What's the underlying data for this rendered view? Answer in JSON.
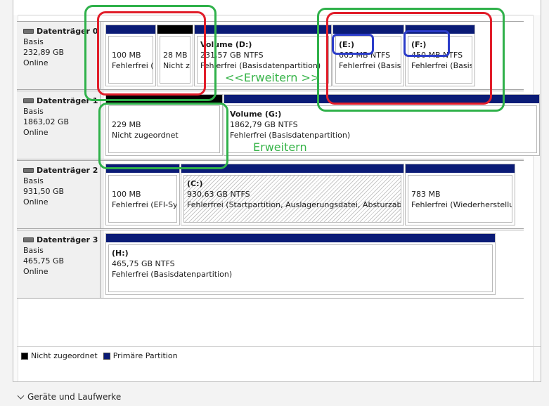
{
  "disks": [
    {
      "title": "Datenträger 0",
      "type": "Basis",
      "size": "232,89 GB",
      "status": "Online",
      "partitions": [
        {
          "l1": "100 MB",
          "l2": "Fehlerfrei ("
        },
        {
          "l1": "28 MB",
          "l2": "Nicht z"
        },
        {
          "l1": "Volume  (D:)",
          "l2": "231,57 GB NTFS",
          "l3": "Fehlerfrei (Basisdatenpartition)"
        },
        {
          "l1": "(E:)",
          "l2": "665 MB NTFS",
          "l3": "Fehlerfrei (Basisd"
        },
        {
          "l1": "(F:)",
          "l2": "450 MB NTFS",
          "l3": "Fehlerfrei (Basis"
        }
      ]
    },
    {
      "title": "Datenträger 1",
      "type": "Basis",
      "size": "1863,02 GB",
      "status": "Online",
      "partitions": [
        {
          "l1": "229 MB",
          "l2": "Nicht zugeordnet"
        },
        {
          "l1": "Volume  (G:)",
          "l2": "1862,79 GB NTFS",
          "l3": "Fehlerfrei (Basisdatenpartition)"
        }
      ]
    },
    {
      "title": "Datenträger 2",
      "type": "Basis",
      "size": "931,50 GB",
      "status": "Online",
      "partitions": [
        {
          "l1": "100 MB",
          "l2": "Fehlerfrei (EFI-Sys"
        },
        {
          "l1": "(C:)",
          "l2": "930,63 GB NTFS",
          "l3": "Fehlerfrei (Startpartition, Auslagerungsdatei, Absturzabbild"
        },
        {
          "l1": "783 MB",
          "l2": "Fehlerfrei (Wiederherstellu"
        }
      ]
    },
    {
      "title": "Datenträger 3",
      "type": "Basis",
      "size": "465,75 GB",
      "status": "Online",
      "partitions": [
        {
          "l1": "(H:)",
          "l2": "465,75 GB NTFS",
          "l3": "Fehlerfrei (Basisdatenpartition)"
        }
      ]
    }
  ],
  "legend": {
    "unallocated": "Nicht zugeordnet",
    "primary": "Primäre Partition"
  },
  "annotations": {
    "extend_d": "<<Erweitern >>",
    "extend_g": "Erweitern"
  },
  "footer": {
    "label": "Geräte und Laufwerke"
  },
  "colors": {
    "primary_bar": "#0a1b76",
    "unallocated_bar": "#000000",
    "annotation_green": "#2fb14a",
    "annotation_red": "#e11d2a",
    "annotation_blue": "#2b3cc9"
  },
  "icons": {
    "disk": "disk-drive-icon",
    "footer_toggle": "chevron-down-icon"
  }
}
